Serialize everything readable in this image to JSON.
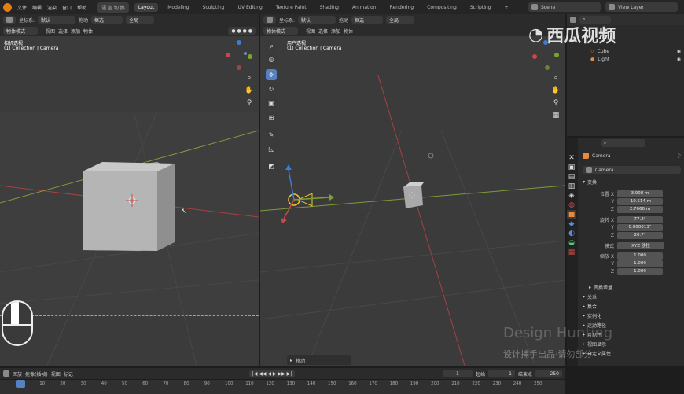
{
  "app": {
    "menus": [
      "文件",
      "编辑",
      "渲染",
      "窗口",
      "帮助"
    ],
    "workspaces": [
      "语 言 切 换",
      "Layout",
      "Modeling",
      "Sculpting",
      "UV Editing",
      "Texture Paint",
      "Shading",
      "Animation",
      "Rendering",
      "Compositing",
      "Scripting"
    ],
    "add_tab": "+",
    "scene": "Scene",
    "view_layer": "View Layer"
  },
  "left_view": {
    "header": {
      "coord_label": "坐标系:",
      "coord_value": "默认",
      "drag_label": "拖动",
      "drag_value": "框选",
      "global": "全局"
    },
    "mode": "物体模式",
    "menu": [
      "视图",
      "选择",
      "添加",
      "物体"
    ],
    "title": "相机透视",
    "subtitle": "(1) Collection | Camera"
  },
  "right_view": {
    "header": {
      "coord_label": "坐标系:",
      "coord_value": "默认",
      "drag_label": "拖动",
      "drag_value": "框选",
      "global": "全局"
    },
    "mode": "物体模式",
    "menu": [
      "视图",
      "选择",
      "添加",
      "物体"
    ],
    "title": "用户透视",
    "subtitle": "(1) Collection | Camera",
    "last_op": "移动"
  },
  "outliner": {
    "items": [
      {
        "label": "Cube",
        "icon": "triangle-icon"
      },
      {
        "label": "Light",
        "icon": "light-icon"
      }
    ]
  },
  "properties": {
    "object_name": "Camera",
    "data_name": "Camera",
    "transform_label": "变换",
    "location_label": "位置 X",
    "location": [
      "3.908 m",
      "-10.514 m",
      "2.7066 m"
    ],
    "rotation_label": "旋转 X",
    "rotation": [
      "77.2°",
      "0.000013°",
      "20.7°"
    ],
    "mode_label": "模式",
    "mode_value": "XYZ 欧拉",
    "scale_label": "缩放 X",
    "scale": [
      "1.000",
      "1.000",
      "1.000"
    ],
    "axis_y": "Y",
    "axis_z": "Z",
    "delta_label": "变换增量",
    "sections": [
      "关系",
      "集合",
      "实例化",
      "运动路径",
      "可见性",
      "视图显示",
      "自定义属性"
    ]
  },
  "timeline": {
    "menu": [
      "回放",
      "抠像(插帧)",
      "视图",
      "标记"
    ],
    "current_frame": "1",
    "start_label": "起始",
    "start": "1",
    "end_label": "结束点",
    "end": "250",
    "ticks": [
      "1",
      "10",
      "20",
      "30",
      "40",
      "50",
      "60",
      "70",
      "80",
      "90",
      "100",
      "110",
      "120",
      "130",
      "140",
      "150",
      "160",
      "170",
      "180",
      "190",
      "200",
      "210",
      "220",
      "230",
      "240",
      "250"
    ]
  },
  "watermark": {
    "brand": "西瓜视频",
    "design": "Design Hunting",
    "sub": "设计捕手出品·请勿部分"
  },
  "colors": {
    "accent": "#5680c2",
    "orange": "#e87d0d",
    "x_axis": "#b33d3d",
    "y_axis": "#7aa52a"
  }
}
